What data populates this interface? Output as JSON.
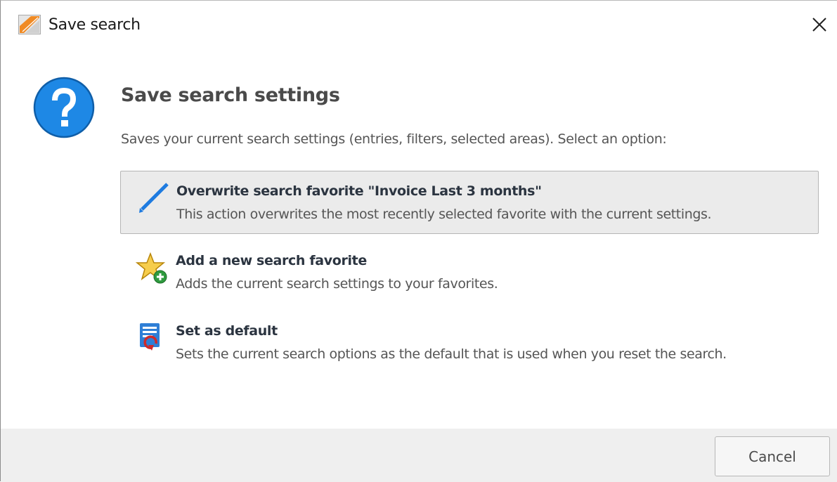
{
  "window": {
    "title": "Save search",
    "close_icon": "close-icon",
    "app_icon": "app-logo-icon"
  },
  "dialog": {
    "icon": "question-icon",
    "heading": "Save search settings",
    "description": "Saves your current search settings (entries, filters, selected areas). Select an option:"
  },
  "options": [
    {
      "icon": "pencil-icon",
      "title": "Overwrite search favorite \"Invoice Last 3 months\"",
      "description": "This action overwrites the most recently selected favorite with the current settings.",
      "selected": true
    },
    {
      "icon": "star-add-icon",
      "title": "Add a new search favorite",
      "description": "Adds the current search settings to your favorites.",
      "selected": false
    },
    {
      "icon": "set-default-icon",
      "title": "Set as default",
      "description": "Sets the current search options as the default that is used when you reset the search.",
      "selected": false
    }
  ],
  "footer": {
    "cancel_label": "Cancel"
  },
  "colors": {
    "help_blue": "#1e88e5",
    "pencil_blue": "#1e7be0",
    "star_yellow": "#f6cd4c",
    "add_green": "#2e9a3e",
    "selected_bg": "#ebebeb",
    "footer_bg": "#efefef"
  }
}
